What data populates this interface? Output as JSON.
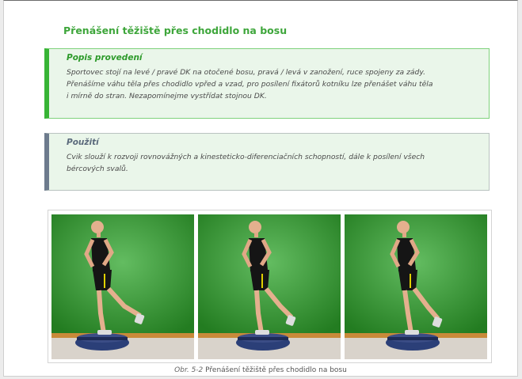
{
  "page_title": "Přenášení těžiště přes chodidlo na bosu",
  "description_box": {
    "heading": "Popis provedení",
    "lines": [
      "Sportovec stojí na levé / pravé DK na otočené bosu, pravá / levá v zanožení, ruce spojeny za zády.",
      "Přenášíme váhu těla přes chodidlo vpřed a vzad, pro posílení fixátorů kotníku lze přenášet váhu těla",
      "i mírně do stran. Nezapomínejme vystřídat stojnou DK."
    ]
  },
  "usage_box": {
    "heading": "Použití",
    "lines": [
      "Cvik slouží k rozvoji rovnovážných a kinesteticko-diferenciačních schopností, dále k posílení všech",
      "bércových svalů."
    ]
  },
  "figure": {
    "label": "Obr. 5-2",
    "caption": "Přenášení těžiště přes chodidlo na bosu",
    "panels": [
      "photo-phase-1",
      "photo-phase-2",
      "photo-phase-3"
    ]
  }
}
